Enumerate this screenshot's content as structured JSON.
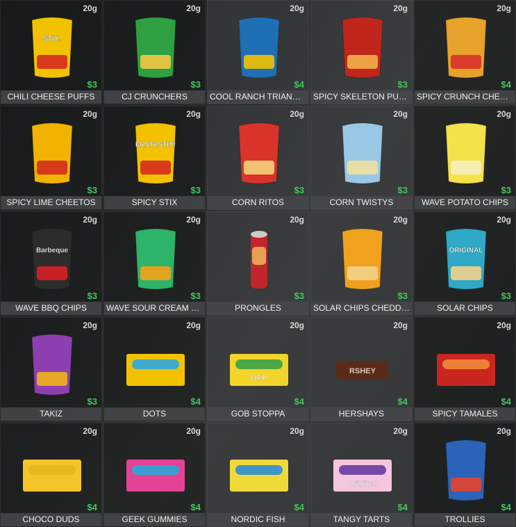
{
  "items": [
    {
      "name": "CHILI CHEESE PUFFS",
      "weight": "20g",
      "price": "$3",
      "kind": "bag",
      "c1": "#f2c200",
      "c2": "#d62b1e",
      "bagText": "STIX!"
    },
    {
      "name": "CJ CRUNCHERS",
      "weight": "20g",
      "price": "$3",
      "kind": "bag",
      "c1": "#2ea043",
      "c2": "#f3c845",
      "bagText": ""
    },
    {
      "name": "COOL RANCH TRIANGL...",
      "weight": "20g",
      "price": "$4",
      "kind": "bag",
      "c1": "#1f6fb5",
      "c2": "#f2c200",
      "bagText": ""
    },
    {
      "name": "SPICY SKELETON PUFFS",
      "weight": "20g",
      "price": "$3",
      "kind": "bag",
      "c1": "#c0261c",
      "c2": "#f4b04a",
      "bagText": ""
    },
    {
      "name": "SPICY CRUNCH CHEET...",
      "weight": "20g",
      "price": "$4",
      "kind": "bag",
      "c1": "#e6a22b",
      "c2": "#d8322b",
      "bagText": ""
    },
    {
      "name": "SPICY LIME CHEETOS",
      "weight": "20g",
      "price": "$3",
      "kind": "bag",
      "c1": "#f2b200",
      "c2": "#d42b1e",
      "bagText": ""
    },
    {
      "name": "SPICY STIX",
      "weight": "20g",
      "price": "$3",
      "kind": "bag",
      "c1": "#f2c200",
      "c2": "#d62b1e",
      "bagText": "FANTASTIX!"
    },
    {
      "name": "CORN RITOS",
      "weight": "20g",
      "price": "$3",
      "kind": "bag",
      "c1": "#d9332a",
      "c2": "#f4d07a",
      "bagText": ""
    },
    {
      "name": "CORN TWISTYS",
      "weight": "20g",
      "price": "$3",
      "kind": "bag",
      "c1": "#9bc7e6",
      "c2": "#f0e0a0",
      "bagText": ""
    },
    {
      "name": "WAVE POTATO CHIPS",
      "weight": "20g",
      "price": "$3",
      "kind": "bag",
      "c1": "#f3e24a",
      "c2": "#f7f0c0",
      "bagText": ""
    },
    {
      "name": "WAVE BBQ CHIPS",
      "weight": "20g",
      "price": "$3",
      "kind": "bag",
      "c1": "#2c2c2c",
      "c2": "#d71f26",
      "bagText": "Barbeque"
    },
    {
      "name": "WAVE SOUR CREAM CH...",
      "weight": "20g",
      "price": "$3",
      "kind": "bag",
      "c1": "#2db36a",
      "c2": "#f4a21a",
      "bagText": ""
    },
    {
      "name": "PRONGLES",
      "weight": "20g",
      "price": "$3",
      "kind": "can",
      "c1": "#c0262c",
      "c2": "#f0c060",
      "bagText": ""
    },
    {
      "name": "SOLAR CHIPS CHEDDAR",
      "weight": "20g",
      "price": "$3",
      "kind": "bag",
      "c1": "#f0a21f",
      "c2": "#f3d28a",
      "bagText": ""
    },
    {
      "name": "SOLAR CHIPS",
      "weight": "20g",
      "price": "$3",
      "kind": "bag",
      "c1": "#2fa9c7",
      "c2": "#f3d28a",
      "bagText": "ORIGINAL"
    },
    {
      "name": "TAKIZ",
      "weight": "20g",
      "price": "$3",
      "kind": "bag",
      "c1": "#8d3fb0",
      "c2": "#f2b21a",
      "bagText": ""
    },
    {
      "name": "DOTS",
      "weight": "20g",
      "price": "$4",
      "kind": "box",
      "c1": "#f2c200",
      "c2": "#2aa9e0",
      "bagText": ""
    },
    {
      "name": "GOB STOPPA",
      "weight": "20g",
      "price": "$4",
      "kind": "box",
      "c1": "#f3d42a",
      "c2": "#3aa24a",
      "bagText": "OPP"
    },
    {
      "name": "HERSHAYS",
      "weight": "20g",
      "price": "$4",
      "kind": "bar",
      "c1": "#5b2b1a",
      "c2": "#d9c8b8",
      "bagText": "RSHEY"
    },
    {
      "name": "SPICY TAMALES",
      "weight": "20g",
      "price": "$4",
      "kind": "box",
      "c1": "#c8261f",
      "c2": "#f28a3a",
      "bagText": ""
    },
    {
      "name": "CHOCO DUDS",
      "weight": "20g",
      "price": "$4",
      "kind": "box",
      "c1": "#f3c52b",
      "c2": "#e7b619",
      "bagText": ""
    },
    {
      "name": "GEEK GUMMIES",
      "weight": "20g",
      "price": "$4",
      "kind": "box",
      "c1": "#e44395",
      "c2": "#2aa7d8",
      "bagText": ""
    },
    {
      "name": "NORDIC FISH",
      "weight": "20g",
      "price": "$4",
      "kind": "box",
      "c1": "#f1d93a",
      "c2": "#2a8fd8",
      "bagText": ""
    },
    {
      "name": "TANGY TARTS",
      "weight": "20g",
      "price": "$4",
      "kind": "box",
      "c1": "#f6c6de",
      "c2": "#6a3aa0",
      "bagText": "Original"
    },
    {
      "name": "TROLLIES",
      "weight": "20g",
      "price": "$4",
      "kind": "bag",
      "c1": "#2a63b8",
      "c2": "#e7412d",
      "bagText": ""
    }
  ]
}
